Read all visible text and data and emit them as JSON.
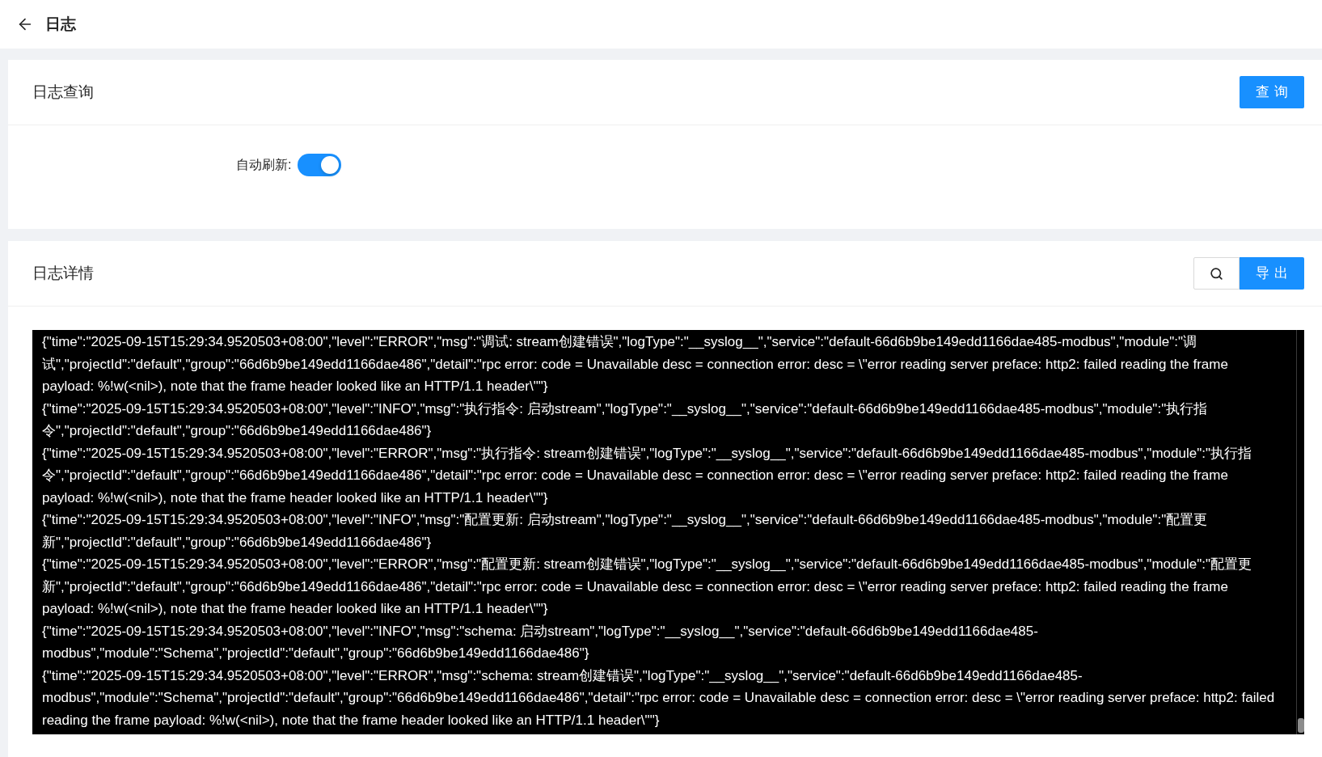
{
  "page": {
    "title": "日志"
  },
  "query_panel": {
    "title": "日志查询",
    "query_button": "查询",
    "auto_refresh": {
      "label": "自动刷新:",
      "on": true
    }
  },
  "detail_panel": {
    "title": "日志详情",
    "export_button": "导出",
    "log_lines": [
      "{\"time\":\"2025-09-15T15:29:34.9520503+08:00\",\"level\":\"ERROR\",\"msg\":\"调试: stream创建错误\",\"logType\":\"__syslog__\",\"service\":\"default-66d6b9be149edd1166dae485-modbus\",\"module\":\"调试\",\"projectId\":\"default\",\"group\":\"66d6b9be149edd1166dae486\",\"detail\":\"rpc error: code = Unavailable desc = connection error: desc = \\\"error reading server preface: http2: failed reading the frame payload: %!w(<nil>), note that the frame header looked like an HTTP/1.1 header\\\"\"}",
      "{\"time\":\"2025-09-15T15:29:34.9520503+08:00\",\"level\":\"INFO\",\"msg\":\"执行指令: 启动stream\",\"logType\":\"__syslog__\",\"service\":\"default-66d6b9be149edd1166dae485-modbus\",\"module\":\"执行指令\",\"projectId\":\"default\",\"group\":\"66d6b9be149edd1166dae486\"}",
      "{\"time\":\"2025-09-15T15:29:34.9520503+08:00\",\"level\":\"ERROR\",\"msg\":\"执行指令: stream创建错误\",\"logType\":\"__syslog__\",\"service\":\"default-66d6b9be149edd1166dae485-modbus\",\"module\":\"执行指令\",\"projectId\":\"default\",\"group\":\"66d6b9be149edd1166dae486\",\"detail\":\"rpc error: code = Unavailable desc = connection error: desc = \\\"error reading server preface: http2: failed reading the frame payload: %!w(<nil>), note that the frame header looked like an HTTP/1.1 header\\\"\"}",
      "{\"time\":\"2025-09-15T15:29:34.9520503+08:00\",\"level\":\"INFO\",\"msg\":\"配置更新: 启动stream\",\"logType\":\"__syslog__\",\"service\":\"default-66d6b9be149edd1166dae485-modbus\",\"module\":\"配置更新\",\"projectId\":\"default\",\"group\":\"66d6b9be149edd1166dae486\"}",
      "{\"time\":\"2025-09-15T15:29:34.9520503+08:00\",\"level\":\"ERROR\",\"msg\":\"配置更新: stream创建错误\",\"logType\":\"__syslog__\",\"service\":\"default-66d6b9be149edd1166dae485-modbus\",\"module\":\"配置更新\",\"projectId\":\"default\",\"group\":\"66d6b9be149edd1166dae486\",\"detail\":\"rpc error: code = Unavailable desc = connection error: desc = \\\"error reading server preface: http2: failed reading the frame payload: %!w(<nil>), note that the frame header looked like an HTTP/1.1 header\\\"\"}",
      "{\"time\":\"2025-09-15T15:29:34.9520503+08:00\",\"level\":\"INFO\",\"msg\":\"schema: 启动stream\",\"logType\":\"__syslog__\",\"service\":\"default-66d6b9be149edd1166dae485-modbus\",\"module\":\"Schema\",\"projectId\":\"default\",\"group\":\"66d6b9be149edd1166dae486\"}",
      "{\"time\":\"2025-09-15T15:29:34.9520503+08:00\",\"level\":\"ERROR\",\"msg\":\"schema: stream创建错误\",\"logType\":\"__syslog__\",\"service\":\"default-66d6b9be149edd1166dae485-modbus\",\"module\":\"Schema\",\"projectId\":\"default\",\"group\":\"66d6b9be149edd1166dae486\",\"detail\":\"rpc error: code = Unavailable desc = connection error: desc = \\\"error reading server preface: http2: failed reading the frame payload: %!w(<nil>), note that the frame header looked like an HTTP/1.1 header\\\"\"}"
    ]
  }
}
